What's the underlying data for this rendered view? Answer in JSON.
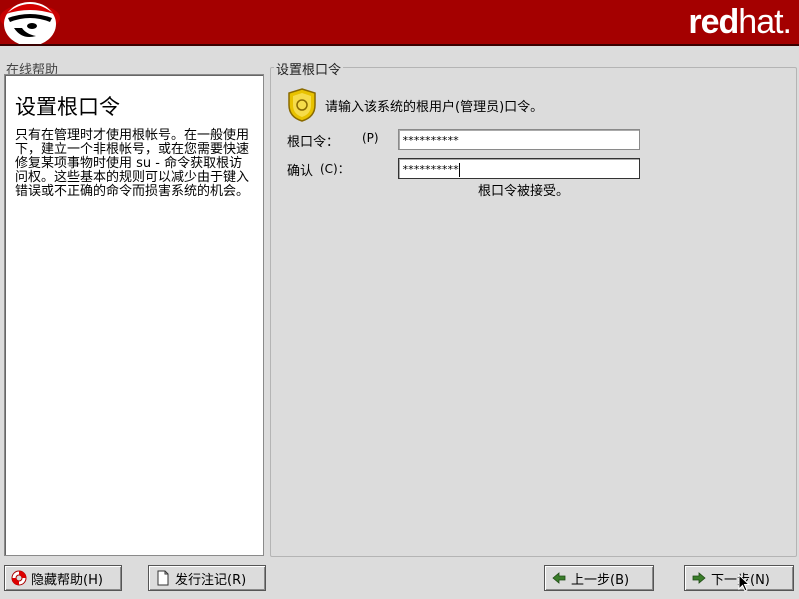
{
  "banner": {
    "brand_bold": "red",
    "brand_light": "hat.",
    "color": "#a40000"
  },
  "help": {
    "frame_label": "在线帮助",
    "title": "设置根口令",
    "body": "只有在管理时才使用根帐号。在一般使用下，建立一个非根帐号，或在您需要快速修复某项事物时使用 su - 命令获取根访问权。这些基本的规则可以减少由于键入错误或不正确的命令而损害系统的机会。"
  },
  "main": {
    "frame_label": "设置根口令",
    "prompt": "请输入该系统的根用户(管理员)口令。",
    "root_password": {
      "label": "根口令：",
      "accel": "(P)",
      "value": "**********"
    },
    "confirm": {
      "label": "确认",
      "accel": "(C)：",
      "value": "**********"
    },
    "status": "根口令被接受。"
  },
  "buttons": {
    "hide_help": "隐藏帮助(H)",
    "release_notes": "发行注记(R)",
    "back": "上一步(B)",
    "next": "下一步(N)"
  },
  "icons": {
    "logo": "shadowman-icon",
    "badge": "badge-icon",
    "hide_help": "lifebuoy-icon",
    "release_notes": "document-icon",
    "back": "arrow-left-icon",
    "next": "arrow-right-icon"
  }
}
